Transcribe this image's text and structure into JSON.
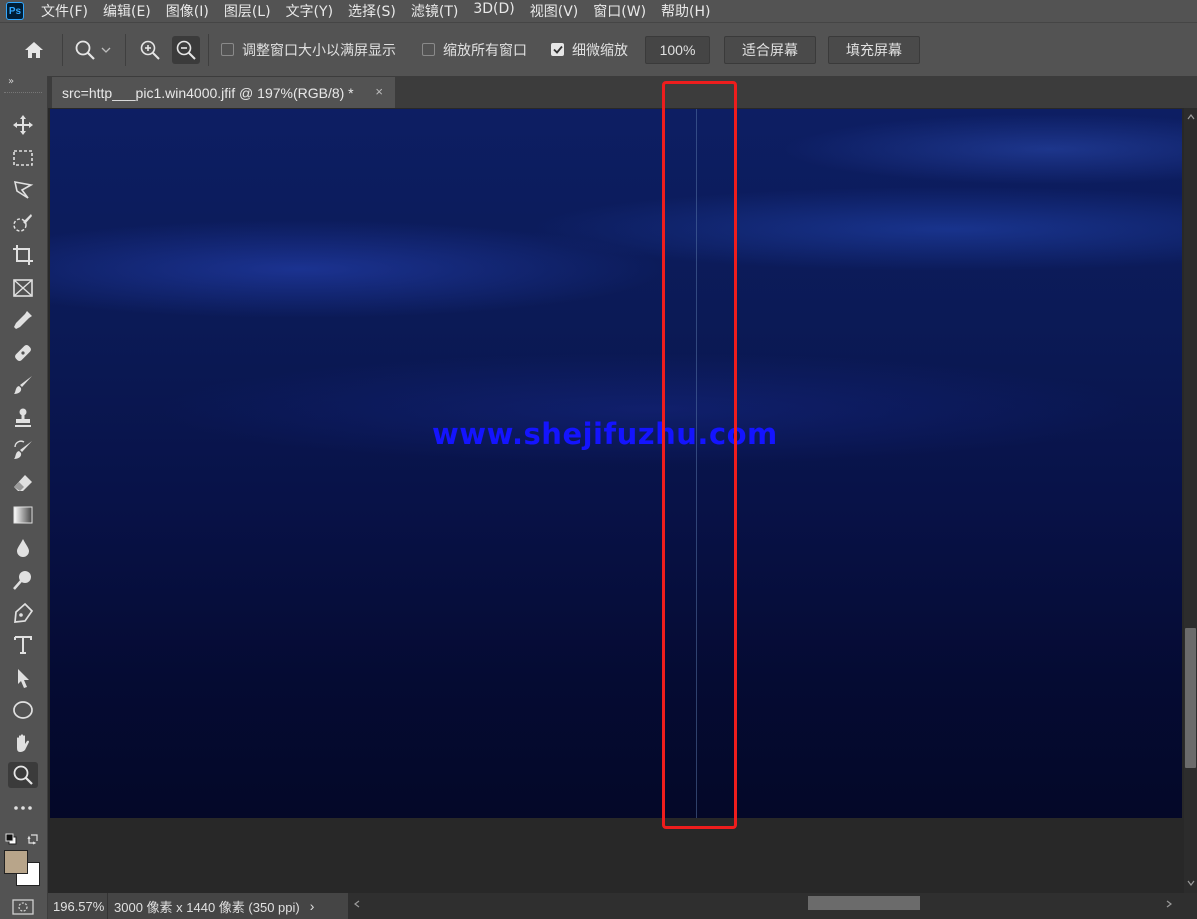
{
  "app": {
    "logo": "Ps"
  },
  "menubar": {
    "items": [
      "文件(F)",
      "编辑(E)",
      "图像(I)",
      "图层(L)",
      "文字(Y)",
      "选择(S)",
      "滤镜(T)",
      "3D(D)",
      "视图(V)",
      "窗口(W)",
      "帮助(H)"
    ]
  },
  "options": {
    "resize_windows_label": "调整窗口大小以满屏显示",
    "resize_windows_checked": false,
    "zoom_all_label": "缩放所有窗口",
    "zoom_all_checked": false,
    "scrubby_zoom_label": "细微缩放",
    "scrubby_zoom_checked": true,
    "percent_value": "100%",
    "fit_screen_label": "适合屏幕",
    "fill_screen_label": "填充屏幕"
  },
  "document": {
    "tab_title": "src=http___pic1.win4000.jfif @ 197%(RGB/8) *",
    "close_glyph": "×",
    "watermark": "www.shejifuzhu.com"
  },
  "status": {
    "zoom": "196.57%",
    "info": "3000 像素 x 1440 像素 (350 ppi)",
    "arrow": "›"
  },
  "colors": {
    "foreground": "#b8a58a",
    "background": "#ffffff",
    "highlight_box": "#ee1d1d",
    "watermark": "#1414ff"
  },
  "tools": [
    "move-tool",
    "marquee-tool",
    "lasso-tool",
    "quick-select-tool",
    "crop-tool",
    "frame-tool",
    "eyedropper-tool",
    "healing-brush-tool",
    "brush-tool",
    "clone-stamp-tool",
    "history-brush-tool",
    "eraser-tool",
    "gradient-tool",
    "blur-tool",
    "dodge-tool",
    "pen-tool",
    "type-tool",
    "path-select-tool",
    "ellipse-tool",
    "hand-tool",
    "zoom-tool",
    "more-tools"
  ]
}
